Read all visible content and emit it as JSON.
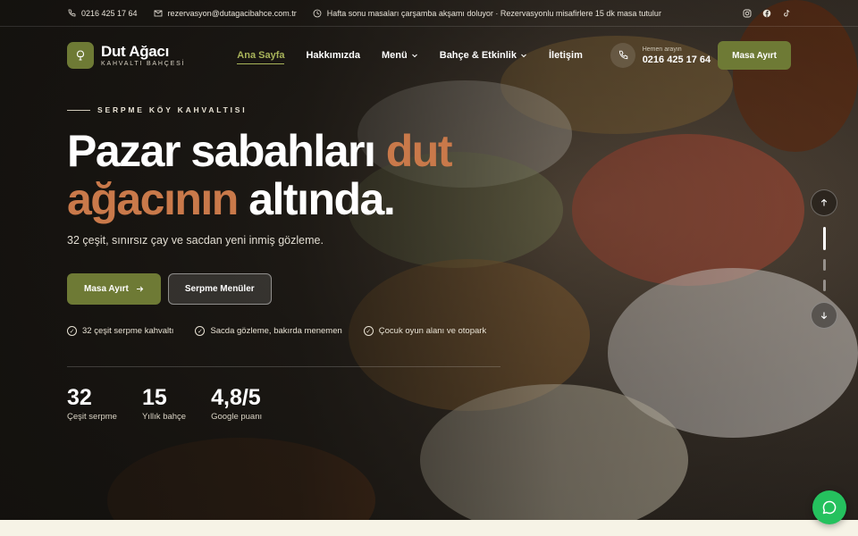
{
  "topbar": {
    "phone": "0216 425 17 64",
    "email": "rezervasyon@dutagacibahce.com.tr",
    "notice": "Hafta sonu masaları çarşamba akşamı doluyor · Rezervasyonlu misafirlere 15 dk masa tutulur",
    "social_icons": [
      "instagram-icon",
      "facebook-icon",
      "tiktok-icon"
    ]
  },
  "brand": {
    "name": "Dut Ağacı",
    "tagline": "KAHVALTI BAHÇESİ"
  },
  "nav": {
    "items": [
      {
        "label": "Ana Sayfa",
        "active": true
      },
      {
        "label": "Hakkımızda"
      },
      {
        "label": "Menü",
        "dropdown": true
      },
      {
        "label": "Bahçe & Etkinlik",
        "dropdown": true
      },
      {
        "label": "İletişim"
      }
    ]
  },
  "call": {
    "label": "Hemen arayın",
    "number": "0216 425 17 64"
  },
  "header_cta": "Masa Ayırt",
  "hero": {
    "eyebrow": "SERPME KÖY KAHVALTISI",
    "headline_1": "Pazar sabahları ",
    "headline_accent_1": "dut",
    "headline_accent_2": "ağacının",
    "headline_2": " altında.",
    "lead": "32 çeşit, sınırsız çay ve sacdan yeni inmiş gözleme.",
    "primary_cta": "Masa Ayırt",
    "secondary_cta": "Serpme Menüler",
    "features": [
      "32 çeşit serpme kahvaltı",
      "Sacda gözleme, bakırda menemen",
      "Çocuk oyun alanı ve otopark"
    ],
    "stats": [
      {
        "value": "32",
        "label": "Çeşit serpme"
      },
      {
        "value": "15",
        "label": "Yıllık bahçe"
      },
      {
        "value": "4,8/5",
        "label": "Google puanı"
      }
    ]
  },
  "slider": {
    "slide_count": 3,
    "active_index": 0
  },
  "colors": {
    "accent_green": "#6e7a35",
    "accent_copper": "#c9794a",
    "active_nav": "#a9b45a",
    "whatsapp": "#25c15e"
  }
}
